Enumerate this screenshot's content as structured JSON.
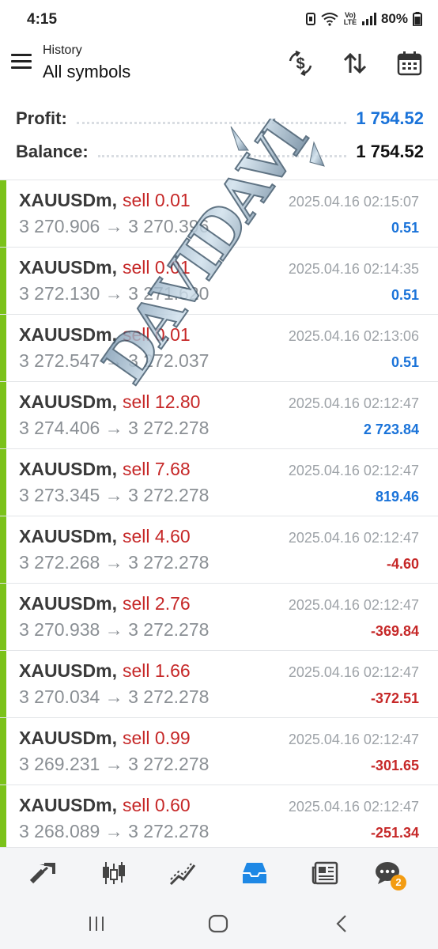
{
  "status_bar": {
    "time": "4:15",
    "network": "Vo) LTE",
    "battery": "80%"
  },
  "header": {
    "subtitle": "History",
    "title": "All symbols",
    "icons": [
      "currency-exchange-icon",
      "sort-icon",
      "calendar-icon"
    ]
  },
  "summary": {
    "profit_label": "Profit:",
    "profit_value": "1 754.52",
    "balance_label": "Balance:",
    "balance_value": "1 754.52"
  },
  "trades": [
    {
      "symbol": "XAUUSDm,",
      "action": "sell 0.01",
      "prices": "3 270.906 → 3 270.396",
      "time": "2025.04.16 02:15:07",
      "profit": "0.51",
      "profit_color": "#1a73d9"
    },
    {
      "symbol": "XAUUSDm,",
      "action": "sell 0.01",
      "prices": "3 272.130 → 3 271.620",
      "time": "2025.04.16 02:14:35",
      "profit": "0.51",
      "profit_color": "#1a73d9"
    },
    {
      "symbol": "XAUUSDm,",
      "action": "sell 0.01",
      "prices": "3 272.547 → 3 272.037",
      "time": "2025.04.16 02:13:06",
      "profit": "0.51",
      "profit_color": "#1a73d9"
    },
    {
      "symbol": "XAUUSDm,",
      "action": "sell 12.80",
      "prices": "3 274.406 → 3 272.278",
      "time": "2025.04.16 02:12:47",
      "profit": "2 723.84",
      "profit_color": "#1a73d9"
    },
    {
      "symbol": "XAUUSDm,",
      "action": "sell 7.68",
      "prices": "3 273.345 → 3 272.278",
      "time": "2025.04.16 02:12:47",
      "profit": "819.46",
      "profit_color": "#1a73d9"
    },
    {
      "symbol": "XAUUSDm,",
      "action": "sell 4.60",
      "prices": "3 272.268 → 3 272.278",
      "time": "2025.04.16 02:12:47",
      "profit": "-4.60",
      "profit_color": "#c62828"
    },
    {
      "symbol": "XAUUSDm,",
      "action": "sell 2.76",
      "prices": "3 270.938 → 3 272.278",
      "time": "2025.04.16 02:12:47",
      "profit": "-369.84",
      "profit_color": "#c62828"
    },
    {
      "symbol": "XAUUSDm,",
      "action": "sell 1.66",
      "prices": "3 270.034 → 3 272.278",
      "time": "2025.04.16 02:12:47",
      "profit": "-372.51",
      "profit_color": "#c62828"
    },
    {
      "symbol": "XAUUSDm,",
      "action": "sell 0.99",
      "prices": "3 269.231 → 3 272.278",
      "time": "2025.04.16 02:12:47",
      "profit": "-301.65",
      "profit_color": "#c62828"
    },
    {
      "symbol": "XAUUSDm,",
      "action": "sell 0.60",
      "prices": "3 268.089 → 3 272.278",
      "time": "2025.04.16 02:12:47",
      "profit": "-251.34",
      "profit_color": "#c62828"
    }
  ],
  "bottom_nav": {
    "items": [
      "quotes-icon",
      "chart-icon",
      "trade-icon",
      "history-icon",
      "news-icon",
      "chat-icon"
    ],
    "active": "history-icon",
    "chat_badge": "2"
  },
  "colors": {
    "profit_positive": "#1a73d9",
    "profit_negative": "#c62828",
    "accent_bar": "#7bc21a",
    "active_nav": "#1e88e5"
  },
  "watermark": {
    "text": "DAVIDAVI"
  }
}
